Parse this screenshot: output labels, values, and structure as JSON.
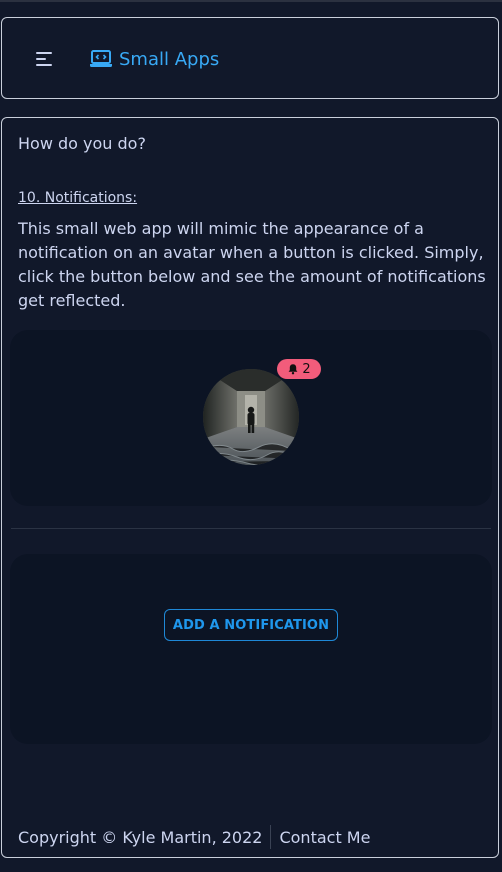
{
  "header": {
    "menu_icon": "hamburger-icon",
    "brand_icon": "laptop-code-icon",
    "brand_label": "Small Apps",
    "accent_color": "#38a9f5"
  },
  "main": {
    "greeting": "How do you do?",
    "section_title": "10. Notifications:",
    "description": "This small web app will mimic the appearance of a notification on an avatar when a button is clicked. Simply, click the button below and see the amount of notifications get reflected.",
    "avatar": {
      "alt": "avatar"
    },
    "notification_badge": {
      "icon": "bell-icon",
      "count": "2",
      "color": "#f25c7b"
    },
    "add_button_label": "ADD A NOTIFICATION"
  },
  "footer": {
    "copyright": "Copyright © Kyle Martin, 2022",
    "contact_label": "Contact Me"
  }
}
